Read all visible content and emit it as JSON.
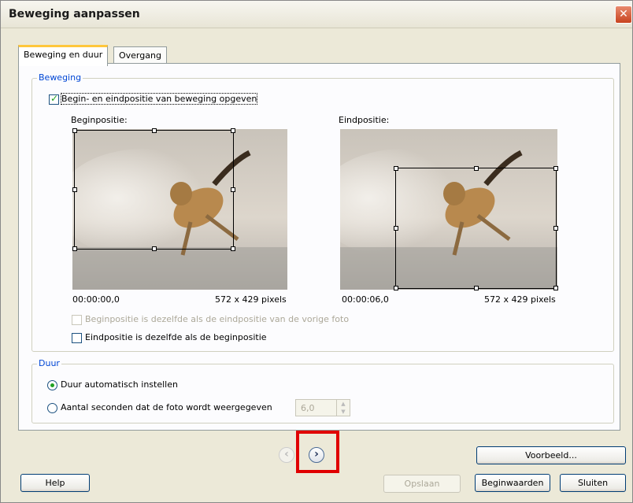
{
  "window": {
    "title": "Beweging aanpassen",
    "close_glyph": "✕"
  },
  "tabs": [
    {
      "label": "Beweging en duur",
      "active": true
    },
    {
      "label": "Overgang",
      "active": false
    }
  ],
  "beweging": {
    "group_label": "Beweging",
    "specify_checkbox": {
      "label": "Begin- en eindpositie van beweging opgeven",
      "checked": true
    },
    "start": {
      "label": "Beginpositie:",
      "time": "00:00:00,0",
      "size": "572 x 429 pixels"
    },
    "end": {
      "label": "Eindpositie:",
      "time": "00:00:06,0",
      "size": "572 x 429 pixels"
    },
    "same_as_prev": {
      "label": "Beginpositie is dezelfde als de eindpositie van de vorige foto",
      "checked": false,
      "enabled": false
    },
    "end_same_as_start": {
      "label": "Eindpositie is dezelfde als de beginpositie",
      "checked": false
    }
  },
  "duur": {
    "group_label": "Duur",
    "auto": {
      "label": "Duur automatisch instellen",
      "selected": true
    },
    "seconds": {
      "label": "Aantal seconden dat de foto wordt weergegeven",
      "selected": false,
      "value": "6,0"
    }
  },
  "nav": {
    "prev_glyph": "‹",
    "next_glyph": "›"
  },
  "buttons": {
    "preview": "Voorbeeld...",
    "help": "Help",
    "save": "Opslaan",
    "reset": "Beginwaarden",
    "close": "Sluiten"
  },
  "colors": {
    "accent": "#0046d5",
    "highlight_box": "#e00000",
    "tab_active": "#ffc73c"
  }
}
